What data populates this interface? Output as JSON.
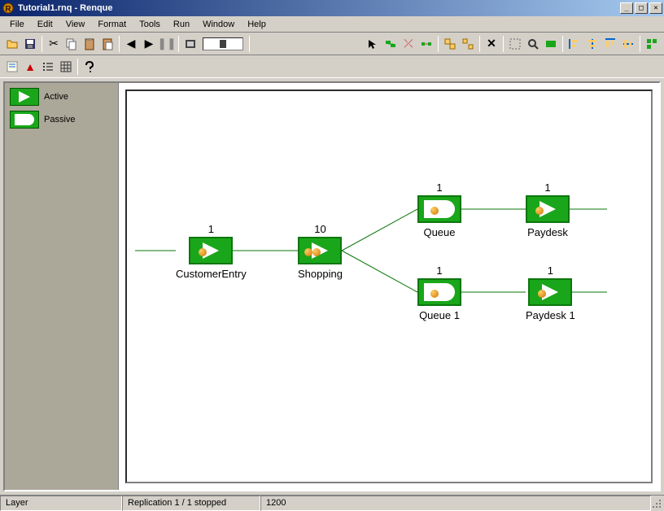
{
  "window": {
    "title": "Tutorial1.rnq - Renque"
  },
  "menu": {
    "file": "File",
    "edit": "Edit",
    "view": "View",
    "format": "Format",
    "tools": "Tools",
    "run": "Run",
    "window": "Window",
    "help": "Help"
  },
  "legend": {
    "active": "Active",
    "passive": "Passive"
  },
  "nodes": {
    "customerEntry": {
      "count": "1",
      "label": "CustomerEntry",
      "type": "active"
    },
    "shopping": {
      "count": "10",
      "label": "Shopping",
      "type": "active"
    },
    "queue": {
      "count": "1",
      "label": "Queue",
      "type": "passive"
    },
    "paydesk": {
      "count": "1",
      "label": "Paydesk",
      "type": "active"
    },
    "queue1": {
      "count": "1",
      "label": "Queue 1",
      "type": "passive"
    },
    "paydesk1": {
      "count": "1",
      "label": "Paydesk 1",
      "type": "active"
    }
  },
  "status": {
    "layer": "Layer",
    "replication": "Replication 1 / 1 stopped",
    "time": "1200"
  },
  "chart_data": {
    "type": "diagram",
    "description": "Discrete-event simulation queue network",
    "nodes": [
      {
        "id": "CustomerEntry",
        "type": "active",
        "tokens": 1
      },
      {
        "id": "Shopping",
        "type": "active",
        "tokens": 10
      },
      {
        "id": "Queue",
        "type": "passive",
        "tokens": 1
      },
      {
        "id": "Paydesk",
        "type": "active",
        "tokens": 1
      },
      {
        "id": "Queue 1",
        "type": "passive",
        "tokens": 1
      },
      {
        "id": "Paydesk 1",
        "type": "active",
        "tokens": 1
      }
    ],
    "edges": [
      {
        "from": "SOURCE",
        "to": "CustomerEntry"
      },
      {
        "from": "CustomerEntry",
        "to": "Shopping"
      },
      {
        "from": "Shopping",
        "to": "Queue"
      },
      {
        "from": "Shopping",
        "to": "Queue 1"
      },
      {
        "from": "Queue",
        "to": "Paydesk"
      },
      {
        "from": "Paydesk",
        "to": "SINK"
      },
      {
        "from": "Queue 1",
        "to": "Paydesk 1"
      },
      {
        "from": "Paydesk 1",
        "to": "SINK"
      }
    ]
  }
}
